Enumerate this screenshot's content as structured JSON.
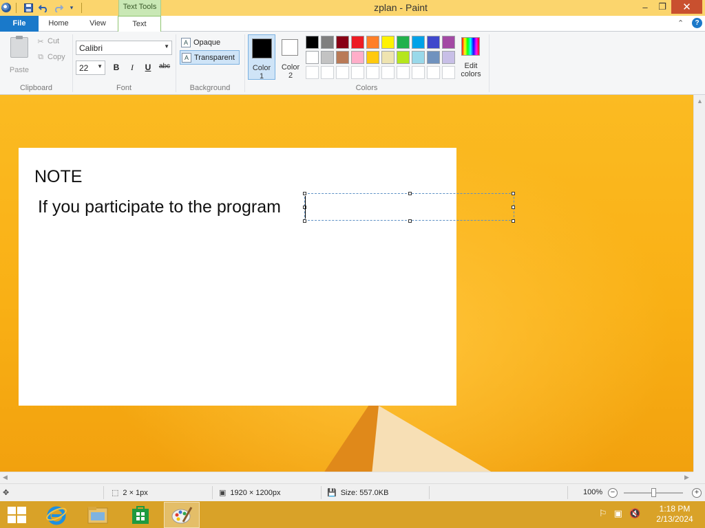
{
  "titlebar": {
    "title": "zplan - Paint",
    "contextual_tab": "Text Tools",
    "minimize": "–",
    "restore": "❐",
    "close": "✕"
  },
  "tabs": {
    "file": "File",
    "home": "Home",
    "view": "View",
    "text": "Text",
    "active": "Text"
  },
  "ribbon": {
    "clipboard": {
      "label": "Clipboard",
      "paste": "Paste",
      "cut": "Cut",
      "copy": "Copy"
    },
    "font": {
      "label": "Font",
      "family": "Calibri",
      "size": "22",
      "bold": "B",
      "italic": "I",
      "underline": "U",
      "strikethrough": "abc"
    },
    "background": {
      "label": "Background",
      "opaque": "Opaque",
      "transparent": "Transparent",
      "selected": "Transparent"
    },
    "colors": {
      "label": "Colors",
      "color1": "Color 1",
      "color2": "Color 2",
      "color1_value": "#000000",
      "color2_value": "#ffffff",
      "edit": "Edit colors",
      "palette": [
        "#000000",
        "#7f7f7f",
        "#880015",
        "#ed1c24",
        "#ff7f27",
        "#fff200",
        "#22b14c",
        "#00a2e8",
        "#3f48cc",
        "#a349a4",
        "#ffffff",
        "#c3c3c3",
        "#b97a57",
        "#ffaec9",
        "#ffc90e",
        "#efe4b0",
        "#b5e61d",
        "#99d9ea",
        "#7092be",
        "#c8bfe7",
        "#ffffff",
        "#ffffff",
        "#ffffff",
        "#ffffff",
        "#ffffff",
        "#ffffff",
        "#ffffff",
        "#ffffff",
        "#ffffff",
        "#ffffff"
      ]
    }
  },
  "canvas": {
    "note_title": "NOTE",
    "note_line": "If you participate to the program"
  },
  "statusbar": {
    "selection_size": "2 × 1px",
    "image_size": "1920 × 1200px",
    "file_size": "Size: 557.0KB",
    "zoom": "100%"
  },
  "taskbar": {
    "apps": [
      "Internet Explorer",
      "File Explorer",
      "Store",
      "Paint"
    ],
    "time": "1:18 PM",
    "date": "2/13/2024"
  }
}
